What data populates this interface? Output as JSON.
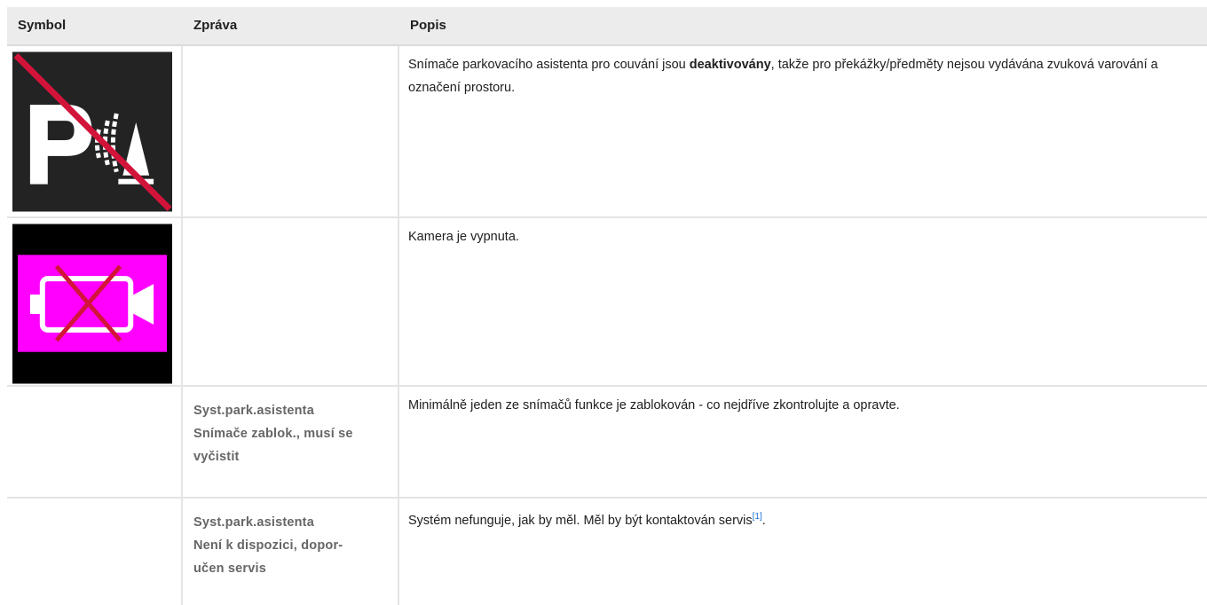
{
  "table": {
    "headers": {
      "symbol": "Symbol",
      "message": "Zpráva",
      "description": "Popis"
    },
    "rows": [
      {
        "symbol_icon": "park-assist-sensors-off-icon",
        "message_lines": [],
        "description_before": "Snímače parkovacího asistenta pro couvání jsou ",
        "description_bold": "deaktivovány",
        "description_after": ", takže pro překážky/předměty nejsou vydávána zvuková varování a označení prostoru."
      },
      {
        "symbol_icon": "camera-off-icon",
        "message_lines": [],
        "description": "Kamera je vypnuta."
      },
      {
        "symbol_icon": "",
        "message_lines": [
          "Syst.park.asistenta",
          "Snímače zablok., musí se",
          "vyčistit"
        ],
        "description": "Minimálně jeden ze snímačů funkce je zablokován - co nejdříve zkontrolujte a opravte."
      },
      {
        "symbol_icon": "",
        "message_lines": [
          "Syst.park.asistenta",
          "Není k dispozici, dopor-",
          "učen servis"
        ],
        "description": "Systém nefunguje, jak by měl. Měl by být kontaktován servis",
        "footnote": "[1]",
        "description_tail": "."
      }
    ]
  },
  "colors": {
    "header_bg": "#ececec",
    "grid_line": "#e4e4e4",
    "icon1_bg": "#232323",
    "icon2_bg": "#ff00ff",
    "strike_red": "#d2143a",
    "link_blue": "#1a6fd6"
  }
}
